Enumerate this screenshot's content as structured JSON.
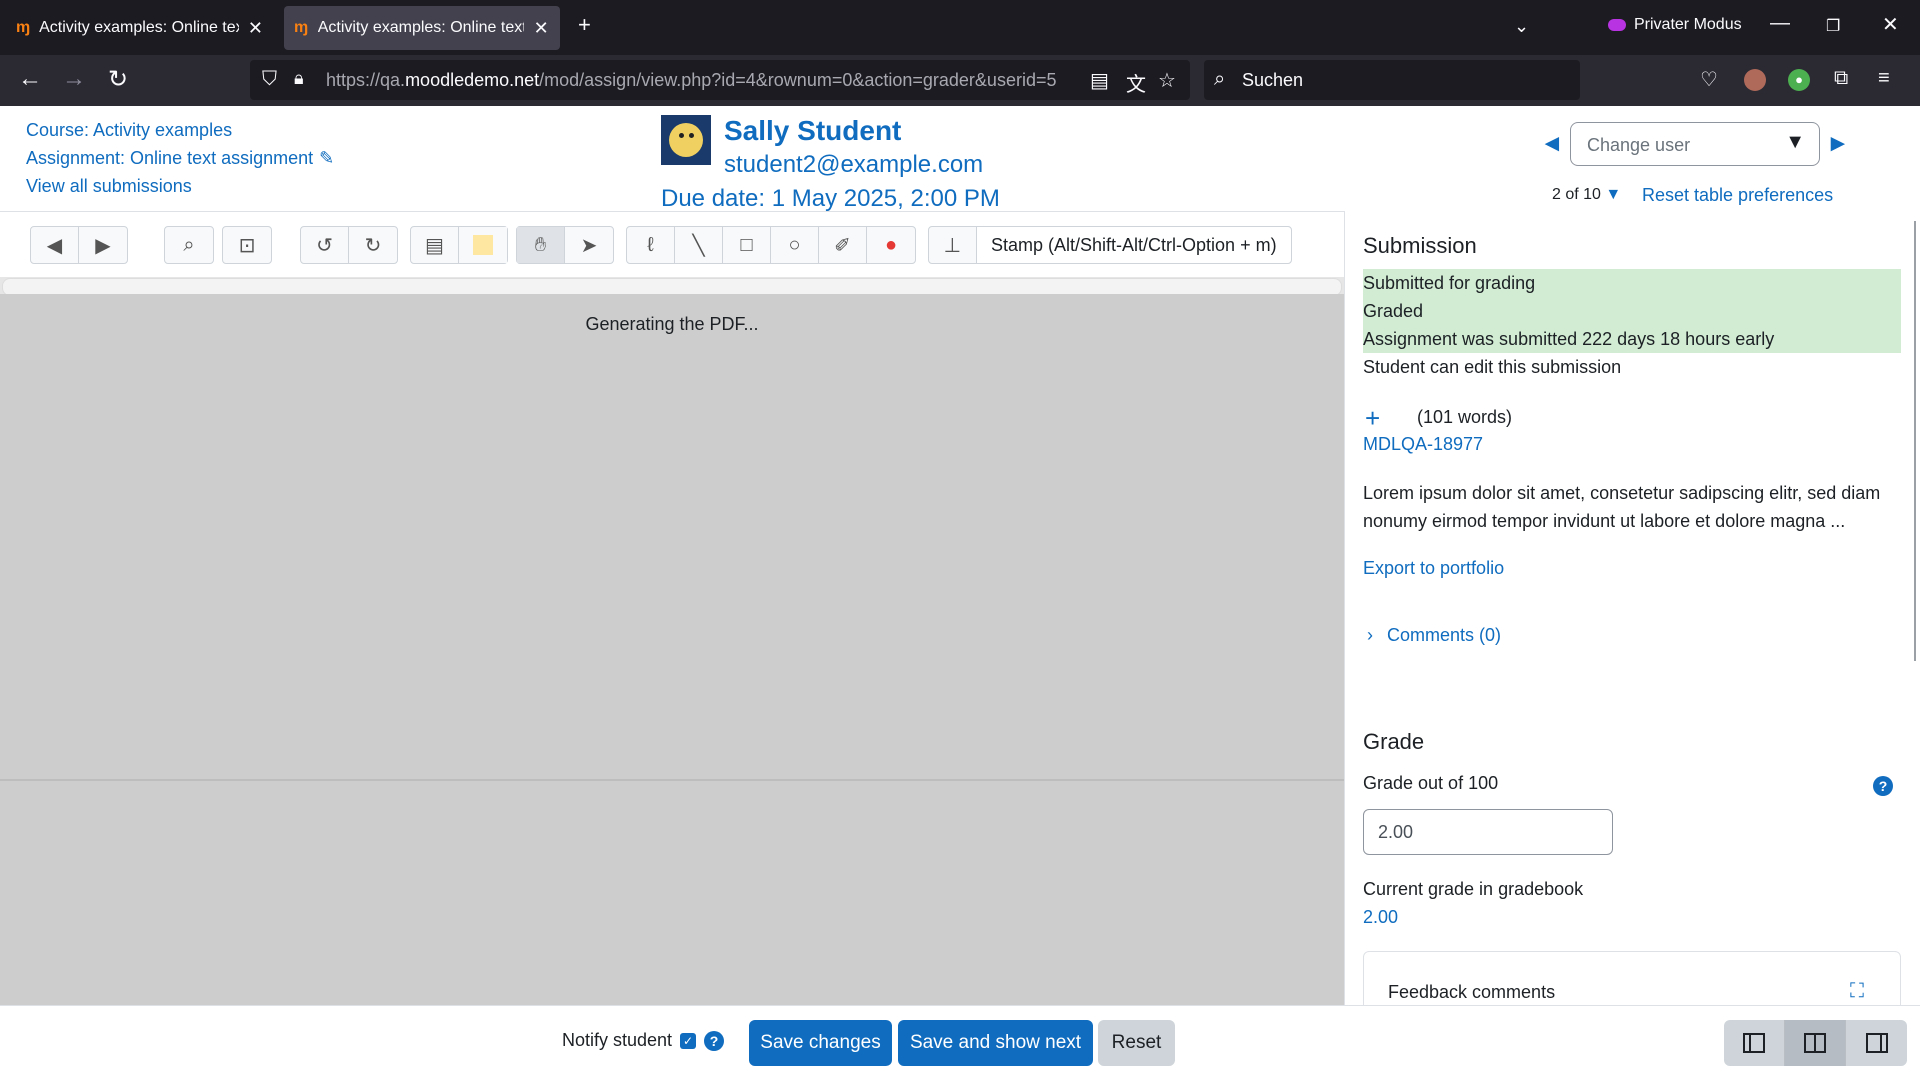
{
  "browser": {
    "tabs": [
      {
        "favicon": "moodle-icon",
        "title": "Activity examples: Online text assignment",
        "active": false
      },
      {
        "favicon": "moodle-icon",
        "title": "Activity examples: Online text assignment",
        "active": true
      }
    ],
    "private_label": "Privater Modus",
    "url_prefix": "https://qa.",
    "url_domain": "moodledemo.net",
    "url_path": "/mod/assign/view.php?id=4&rownum=0&action=grader&userid=5",
    "search_placeholder": "Suchen"
  },
  "header": {
    "course_link": "Course: Activity examples",
    "assignment_link": "Assignment: Online text assignment",
    "view_all_link": "View all submissions",
    "user_name": "Sally Student",
    "user_email": "student2@example.com",
    "due_date": "Due date: 1 May 2025, 2:00 PM",
    "change_user_placeholder": "Change user",
    "counter": "2 of 10",
    "reset_prefs": "Reset table preferences"
  },
  "toolbar": {
    "stamp_label": "Stamp (Alt/Shift-Alt/Ctrl-Option + m)",
    "colors": {
      "highlight": "#fde7a1",
      "annotation": "#e53935"
    }
  },
  "editor": {
    "generating_text": "Generating the PDF..."
  },
  "submission": {
    "title": "Submission",
    "status_lines": [
      "Submitted for grading",
      "Graded",
      "Assignment was submitted 222 days 18 hours early"
    ],
    "edit_status": "Student can edit this submission",
    "word_count": "(101 words)",
    "submission_title": "MDLQA-18977",
    "excerpt": "Lorem ipsum dolor sit amet, consetetur sadipscing elitr, sed diam nonumy eirmod tempor invidunt ut labore et dolore magna ...",
    "export_link": "Export to portfolio",
    "comments_link": "Comments (0)"
  },
  "grade": {
    "title": "Grade",
    "grade_out_label": "Grade out of 100",
    "grade_value": "2.00",
    "current_grade_label": "Current grade in gradebook",
    "current_grade_value": "2.00",
    "feedback_label": "Feedback comments"
  },
  "actions": {
    "notify_label": "Notify student",
    "notify_checked": true,
    "save_changes": "Save changes",
    "save_and_next": "Save and show next",
    "reset": "Reset"
  }
}
